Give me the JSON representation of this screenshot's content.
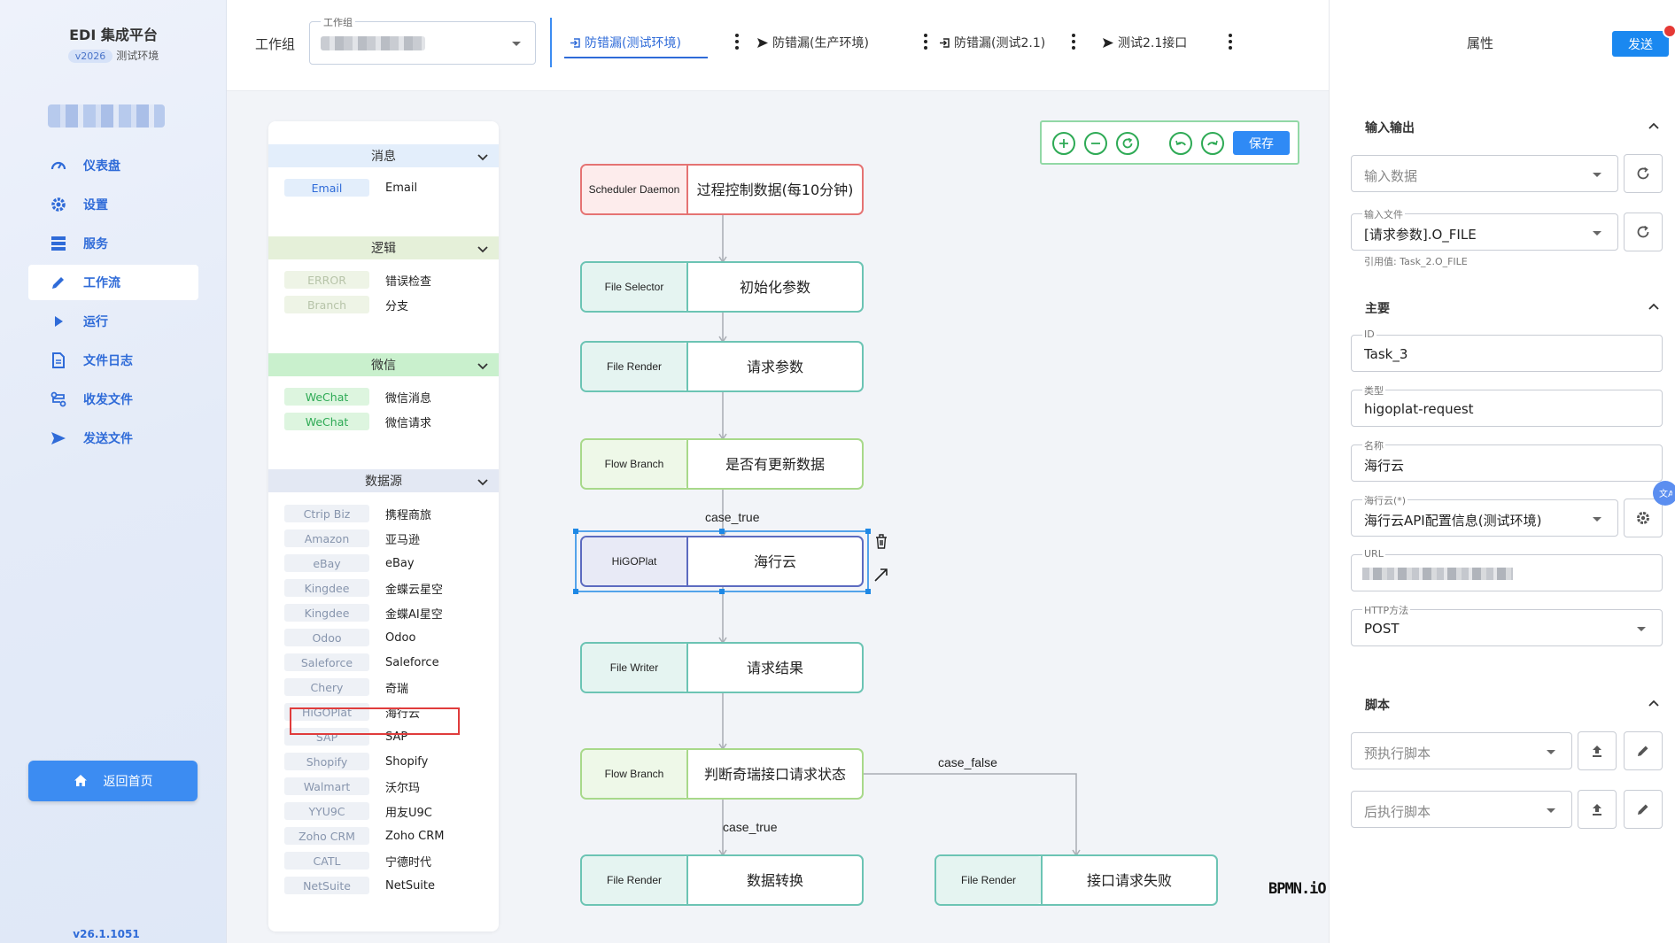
{
  "sidebar": {
    "title": "EDI 集成平台",
    "version_pill": "v2026",
    "env": "测试环境",
    "items": [
      {
        "label": "仪表盘",
        "icon": "gauge-icon"
      },
      {
        "label": "设置",
        "icon": "gear-icon"
      },
      {
        "label": "服务",
        "icon": "server-icon"
      },
      {
        "label": "工作流",
        "icon": "pencil-icon",
        "active": true
      },
      {
        "label": "运行",
        "icon": "play-icon"
      },
      {
        "label": "文件日志",
        "icon": "file-icon"
      },
      {
        "label": "收发文件",
        "icon": "transfer-icon"
      },
      {
        "label": "发送文件",
        "icon": "send-icon"
      }
    ],
    "home_button": "返回首页",
    "footer_version": "v26.1.1051"
  },
  "topbar": {
    "group_label": "工作组",
    "group_select_legend": "工作组",
    "tabs": [
      {
        "label": "防错漏(测试环境)",
        "icon": "login-icon",
        "active": true
      },
      {
        "label": "防错漏(生产环境)",
        "icon": "send-icon"
      },
      {
        "label": "防错漏(测试2.1)",
        "icon": "login-icon"
      },
      {
        "label": "测试2.1接口",
        "icon": "send-icon"
      }
    ]
  },
  "palette": {
    "categories": [
      {
        "title": "消息",
        "color": "#e3eefb",
        "items": [
          {
            "tag": "Email",
            "label": "Email"
          }
        ]
      },
      {
        "title": "逻辑",
        "color": "#e5f0d9",
        "items": [
          {
            "tag": "ERROR",
            "label": "错误检查"
          },
          {
            "tag": "Branch",
            "label": "分支"
          }
        ]
      },
      {
        "title": "微信",
        "color": "#c9f0cd",
        "items": [
          {
            "tag": "WeChat",
            "label": "微信消息"
          },
          {
            "tag": "WeChat",
            "label": "微信请求"
          }
        ]
      },
      {
        "title": "数据源",
        "color": "#e3e8f3",
        "items": [
          {
            "tag": "Ctrip Biz",
            "label": "携程商旅"
          },
          {
            "tag": "Amazon",
            "label": "亚马逊"
          },
          {
            "tag": "eBay",
            "label": "eBay"
          },
          {
            "tag": "Kingdee",
            "label": "金蝶云星空"
          },
          {
            "tag": "Kingdee",
            "label": "金蝶AI星空"
          },
          {
            "tag": "Odoo",
            "label": "Odoo"
          },
          {
            "tag": "Saleforce",
            "label": "Saleforce"
          },
          {
            "tag": "Chery",
            "label": "奇瑞"
          },
          {
            "tag": "HiGOPlat",
            "label": "海行云"
          },
          {
            "tag": "SAP",
            "label": "SAP"
          },
          {
            "tag": "Shopify",
            "label": "Shopify"
          },
          {
            "tag": "Walmart",
            "label": "沃尔玛"
          },
          {
            "tag": "YYU9C",
            "label": "用友U9C"
          },
          {
            "tag": "Zoho CRM",
            "label": "Zoho CRM"
          },
          {
            "tag": "CATL",
            "label": "宁德时代"
          },
          {
            "tag": "NetSuite",
            "label": "NetSuite"
          }
        ]
      }
    ]
  },
  "toolbar": {
    "save_label": "保存"
  },
  "diagram": {
    "nodes": [
      {
        "type": "Scheduler Daemon",
        "label": "过程控制数据(每10分钟)",
        "style": "red"
      },
      {
        "type": "File Selector",
        "label": "初始化参数",
        "style": "teal"
      },
      {
        "type": "File Render",
        "label": "请求参数",
        "style": "teal"
      },
      {
        "type": "Flow Branch",
        "label": "是否有更新数据",
        "style": "green"
      },
      {
        "type": "HiGOPlat",
        "label": "海行云",
        "style": "blue",
        "selected": true
      },
      {
        "type": "File Writer",
        "label": "请求结果",
        "style": "teal"
      },
      {
        "type": "Flow Branch",
        "label": "判断奇瑞接口请求状态",
        "style": "green"
      },
      {
        "type": "File Render",
        "label": "数据转换",
        "style": "teal"
      },
      {
        "type": "File Render",
        "label": "接口请求失败",
        "style": "teal"
      }
    ],
    "edge_labels": [
      "case_true",
      "case_false",
      "case_true"
    ],
    "logo": "BPMN.iO"
  },
  "properties": {
    "title": "属性",
    "send_label": "发送",
    "io_section": "输入输出",
    "input_data_placeholder": "输入数据",
    "input_file_label": "输入文件",
    "input_file_value": "[请求参数].O_FILE",
    "input_file_ref": "引用值: Task_2.O_FILE",
    "main_section": "主要",
    "id_label": "ID",
    "id_value": "Task_3",
    "type_label": "类型",
    "type_value": "higoplat-request",
    "name_label": "名称",
    "name_value": "海行云",
    "config_label": "海行云(*)",
    "config_value": "海行云API配置信息(测试环境)",
    "url_label": "URL",
    "method_label": "HTTP方法",
    "method_value": "POST",
    "script_section": "脚本",
    "pre_script_placeholder": "预执行脚本",
    "post_script_placeholder": "后执行脚本"
  },
  "colors": {
    "accent": "#2f6bd8",
    "primary_button": "#1a88f0",
    "highlight": "#e03c3c"
  }
}
